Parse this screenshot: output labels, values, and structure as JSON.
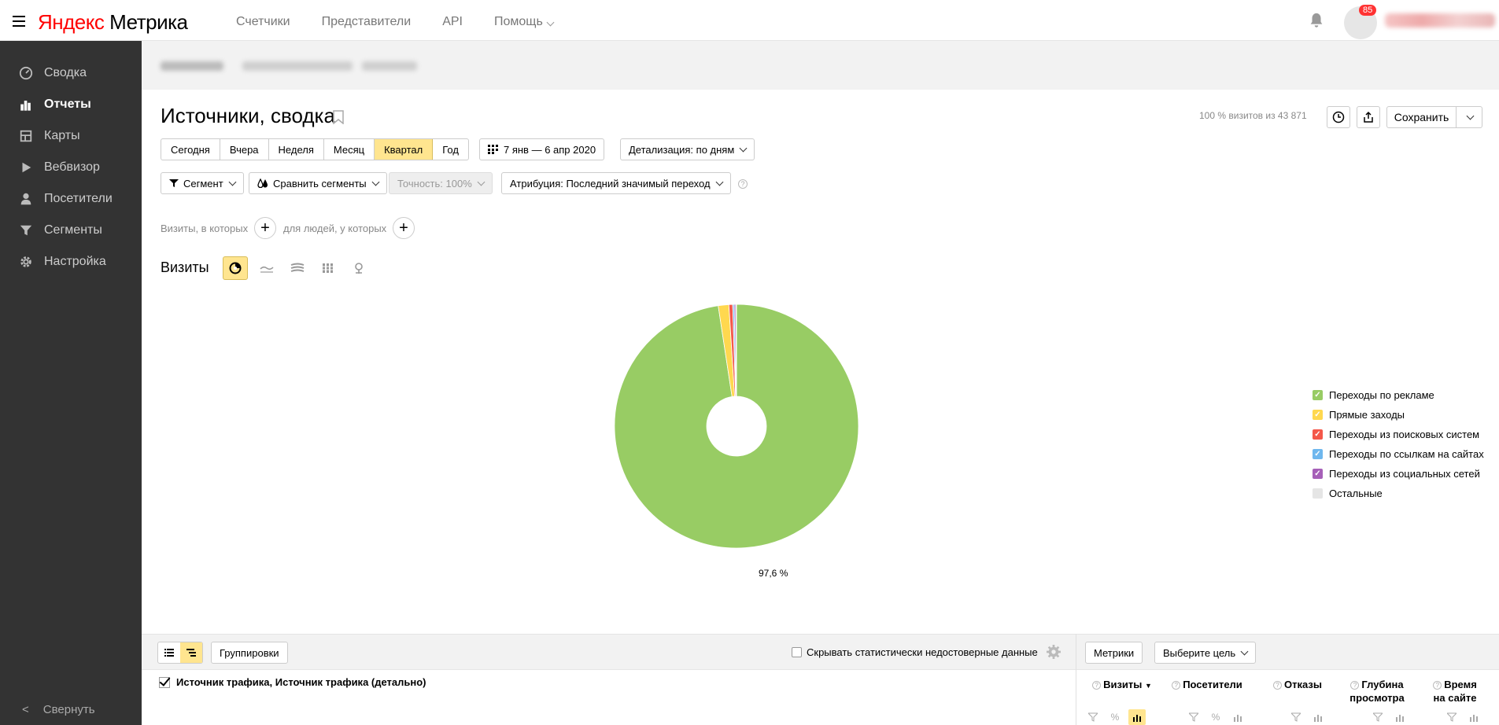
{
  "header": {
    "logo_ya": "Яндекс",
    "logo_rest": " Метрика",
    "nav": [
      "Счетчики",
      "Представители",
      "API",
      "Помощь"
    ],
    "notifications_count": "85"
  },
  "sidebar": {
    "items": [
      {
        "label": "Сводка",
        "icon": "dashboard-icon"
      },
      {
        "label": "Отчеты",
        "icon": "reports-icon"
      },
      {
        "label": "Карты",
        "icon": "maps-icon"
      },
      {
        "label": "Вебвизор",
        "icon": "play-icon"
      },
      {
        "label": "Посетители",
        "icon": "user-icon"
      },
      {
        "label": "Сегменты",
        "icon": "filter-icon"
      },
      {
        "label": "Настройка",
        "icon": "gear-icon"
      }
    ],
    "active_index": 1,
    "collapse_label": "Свернуть"
  },
  "report": {
    "title": "Источники, сводка",
    "visits_info": "100 % визитов из 43 871",
    "save_label": "Сохранить",
    "periods": [
      "Сегодня",
      "Вчера",
      "Неделя",
      "Месяц",
      "Квартал",
      "Год"
    ],
    "selected_period": "Квартал",
    "date_range": "7 янв — 6 апр 2020",
    "detail": "Детализация: по дням",
    "segment": "Сегмент",
    "compare": "Сравнить сегменты",
    "accuracy": "Точность: 100%",
    "attribution": "Атрибуция: Последний значимый переход",
    "cond_visits": "Визиты, в которых",
    "cond_people": "для людей, у которых",
    "visits_label": "Визиты"
  },
  "chart_data": {
    "type": "pie",
    "donut": true,
    "categories": [
      "Переходы по рекламе",
      "Прямые заходы",
      "Переходы из поисковых систем",
      "Переходы по ссылкам на сайтах",
      "Переходы из социальных сетей",
      "Остальные"
    ],
    "values": [
      97.6,
      1.4,
      0.5,
      0.2,
      0.2,
      0.1
    ],
    "colors": [
      "#98cc64",
      "#ffd84f",
      "#f4584a",
      "#6fb7ee",
      "#a660b8",
      "#e5e5e5"
    ],
    "data_label": "97,6 %",
    "legend_position": "right"
  },
  "table": {
    "groupings_label": "Группировки",
    "hide_unreliable": "Скрывать статистически недостоверные данные",
    "metrics_label": "Метрики",
    "goal_label": "Выберите цель",
    "dimensions": "Источник трафика, Источник трафика (детально)",
    "columns": [
      "Визиты",
      "Посетители",
      "Отказы",
      "Глубина просмотра",
      "Время на сайте"
    ]
  }
}
